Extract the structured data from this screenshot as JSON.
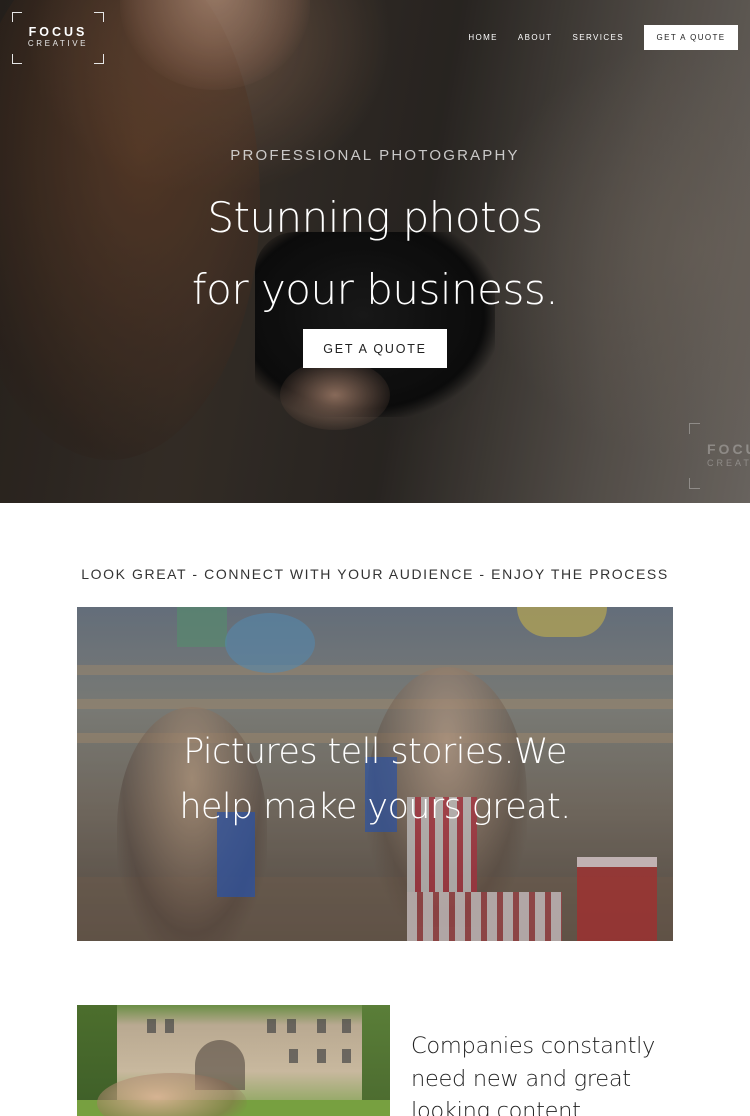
{
  "brand": {
    "name": "FOCUS",
    "subname": "CREATIVE"
  },
  "nav": {
    "items": [
      "HOME",
      "ABOUT",
      "SERVICES"
    ],
    "cta": "GET A QUOTE"
  },
  "hero": {
    "eyebrow": "PROFESSIONAL PHOTOGRAPHY",
    "title_line1": "Stunning photos",
    "title_line2": "for your business.",
    "cta": "GET A QUOTE",
    "watermark_name": "FOCUS",
    "watermark_sub": "CREATIVE"
  },
  "tagline": "LOOK GREAT - CONNECT WITH YOUR AUDIENCE - ENJOY THE PROCESS",
  "story": {
    "line1": "Pictures tell stories.We",
    "line2": "help make yours great."
  },
  "companies": {
    "line1": "Companies constantly",
    "line2": "need new and great",
    "line3": "looking content"
  },
  "colors": {
    "hero_text": "#ffffff",
    "button_bg": "#ffffff",
    "button_text": "#222222",
    "body_text": "#333333"
  }
}
